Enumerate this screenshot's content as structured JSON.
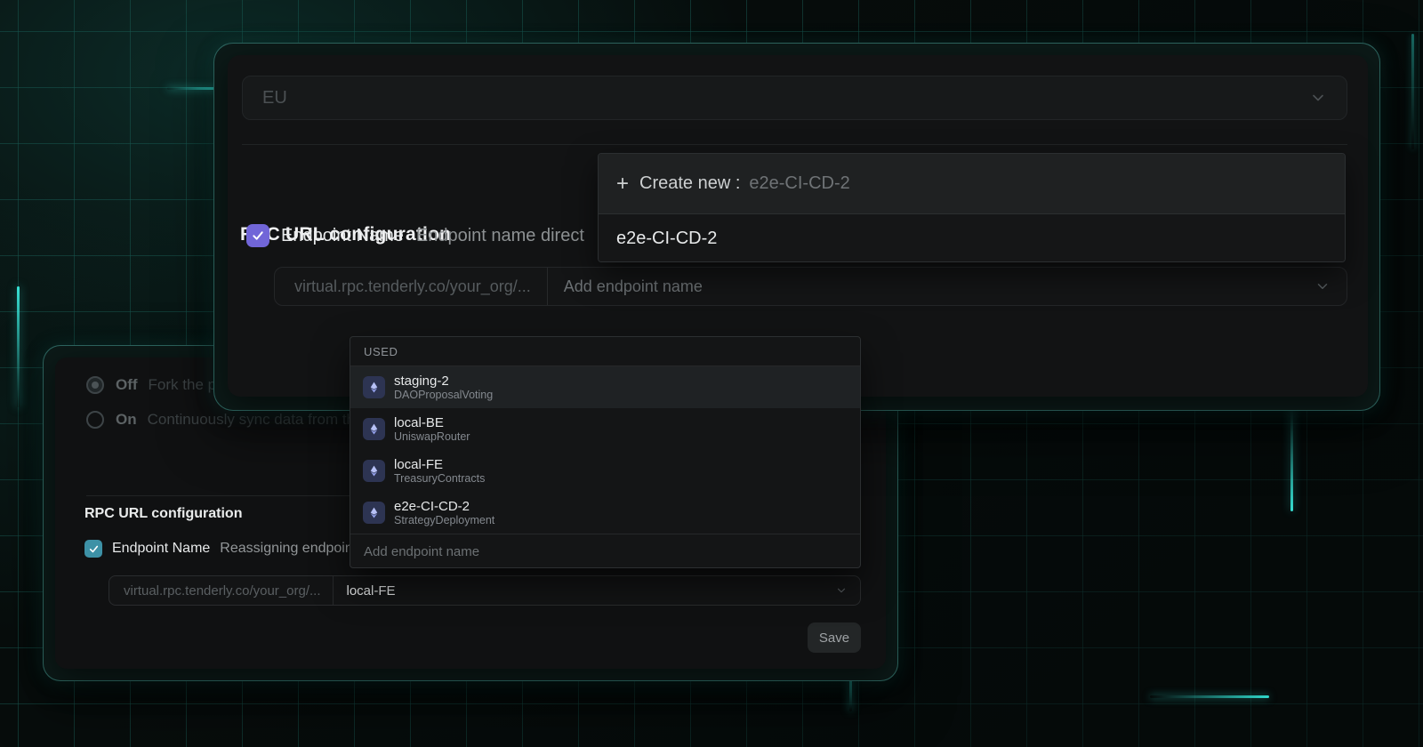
{
  "top_card": {
    "region_select": {
      "value": "EU"
    },
    "heading": "RPC URL configuration",
    "endpoint_checkbox": {
      "label": "Endpoint Name",
      "description": "Endpoint name direct",
      "checked": true
    },
    "rpc_input": {
      "prefix": "virtual.rpc.tenderly.co/your_org/...",
      "placeholder": "Add endpoint name"
    },
    "create_dropdown": {
      "create_label": "Create new :",
      "create_value": "e2e-CI-CD-2",
      "option": "e2e-CI-CD-2"
    },
    "endpoint_dropdown": {
      "section_label": "USED",
      "items": [
        {
          "name": "staging-2",
          "project": "DAOProposalVoting",
          "highlighted": true
        },
        {
          "name": "local-BE",
          "project": "UniswapRouter",
          "highlighted": false
        },
        {
          "name": "local-FE",
          "project": "TreasuryContracts",
          "highlighted": false
        },
        {
          "name": "e2e-CI-CD-2",
          "project": "StrategyDeployment",
          "highlighted": false
        }
      ],
      "input_placeholder": "Add endpoint name"
    }
  },
  "bottom_card": {
    "radios": [
      {
        "label": "Off",
        "description": "Fork the par",
        "selected": true
      },
      {
        "label": "On",
        "description": "Continuously sync data from the p",
        "selected": false
      }
    ],
    "heading": "RPC URL configuration",
    "endpoint_checkbox": {
      "label": "Endpoint Name",
      "description": "Reassigning endpoint",
      "checked": true
    },
    "rpc_input": {
      "prefix": "virtual.rpc.tenderly.co/your_org/...",
      "value": "local-FE"
    },
    "save_button": "Save"
  },
  "colors": {
    "accent_glow": "#2fd8cb",
    "ring_border": "#4aa69c",
    "checkbox_purple": "#7166d8",
    "checkbox_teal": "#3d91a6",
    "eth_badge_bg": "#2d3452",
    "eth_glyph": "#aeb9f3",
    "card_bg": "#121314",
    "dropdown_bg": "#141516",
    "highlight_row_bg": "#1f2224"
  }
}
